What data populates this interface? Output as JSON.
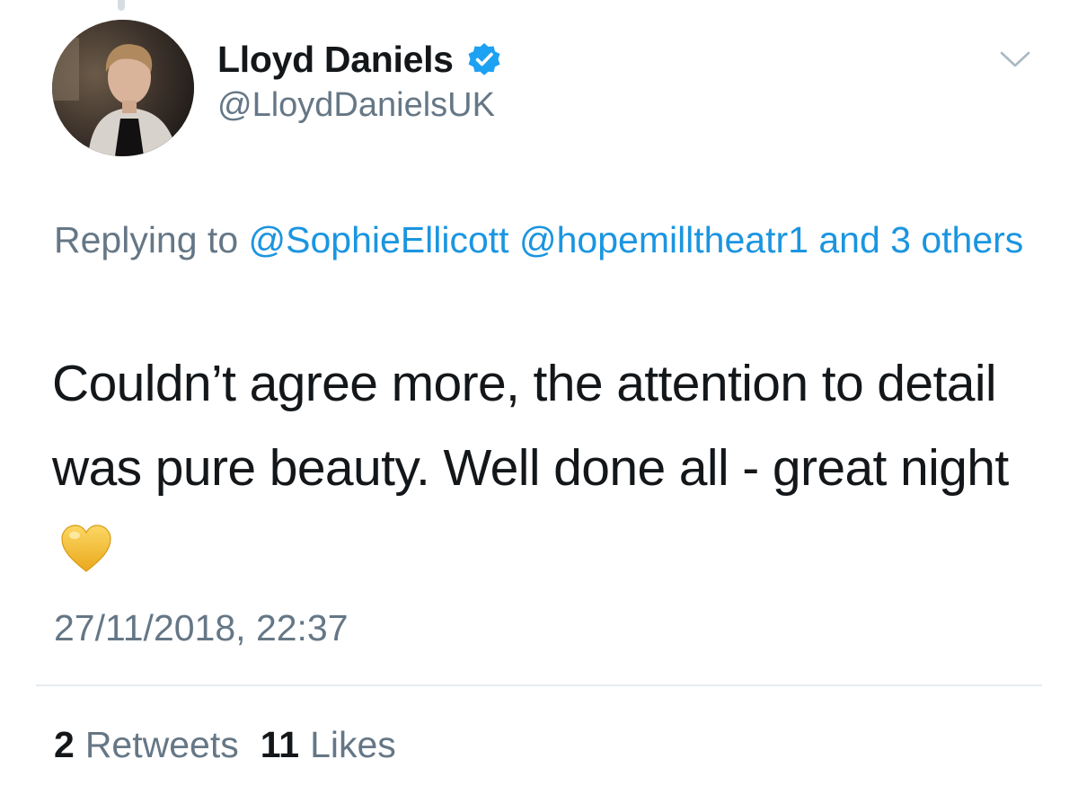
{
  "tweet": {
    "author": {
      "display_name": "Lloyd Daniels",
      "handle": "@LloydDanielsUK",
      "verified": true
    },
    "reply_context": {
      "prefix": "Replying to",
      "mentions": [
        "@SophieEllicott",
        "@hopemilltheatr1"
      ],
      "suffix": "and 3 others"
    },
    "text": "Couldn’t agree more, the attention to detail was pure beauty. Well done all - great night",
    "emoji": "yellow-heart-icon",
    "timestamp": "27/11/2018, 22:37",
    "stats": {
      "retweets_count": "2",
      "retweets_label": "Retweets",
      "likes_count": "11",
      "likes_label": "Likes"
    }
  },
  "colors": {
    "accent": "#1b95e0",
    "secondary_text": "#657786",
    "primary_text": "#14171a",
    "verified": "#1da1f2",
    "heart": "#f4c542"
  }
}
